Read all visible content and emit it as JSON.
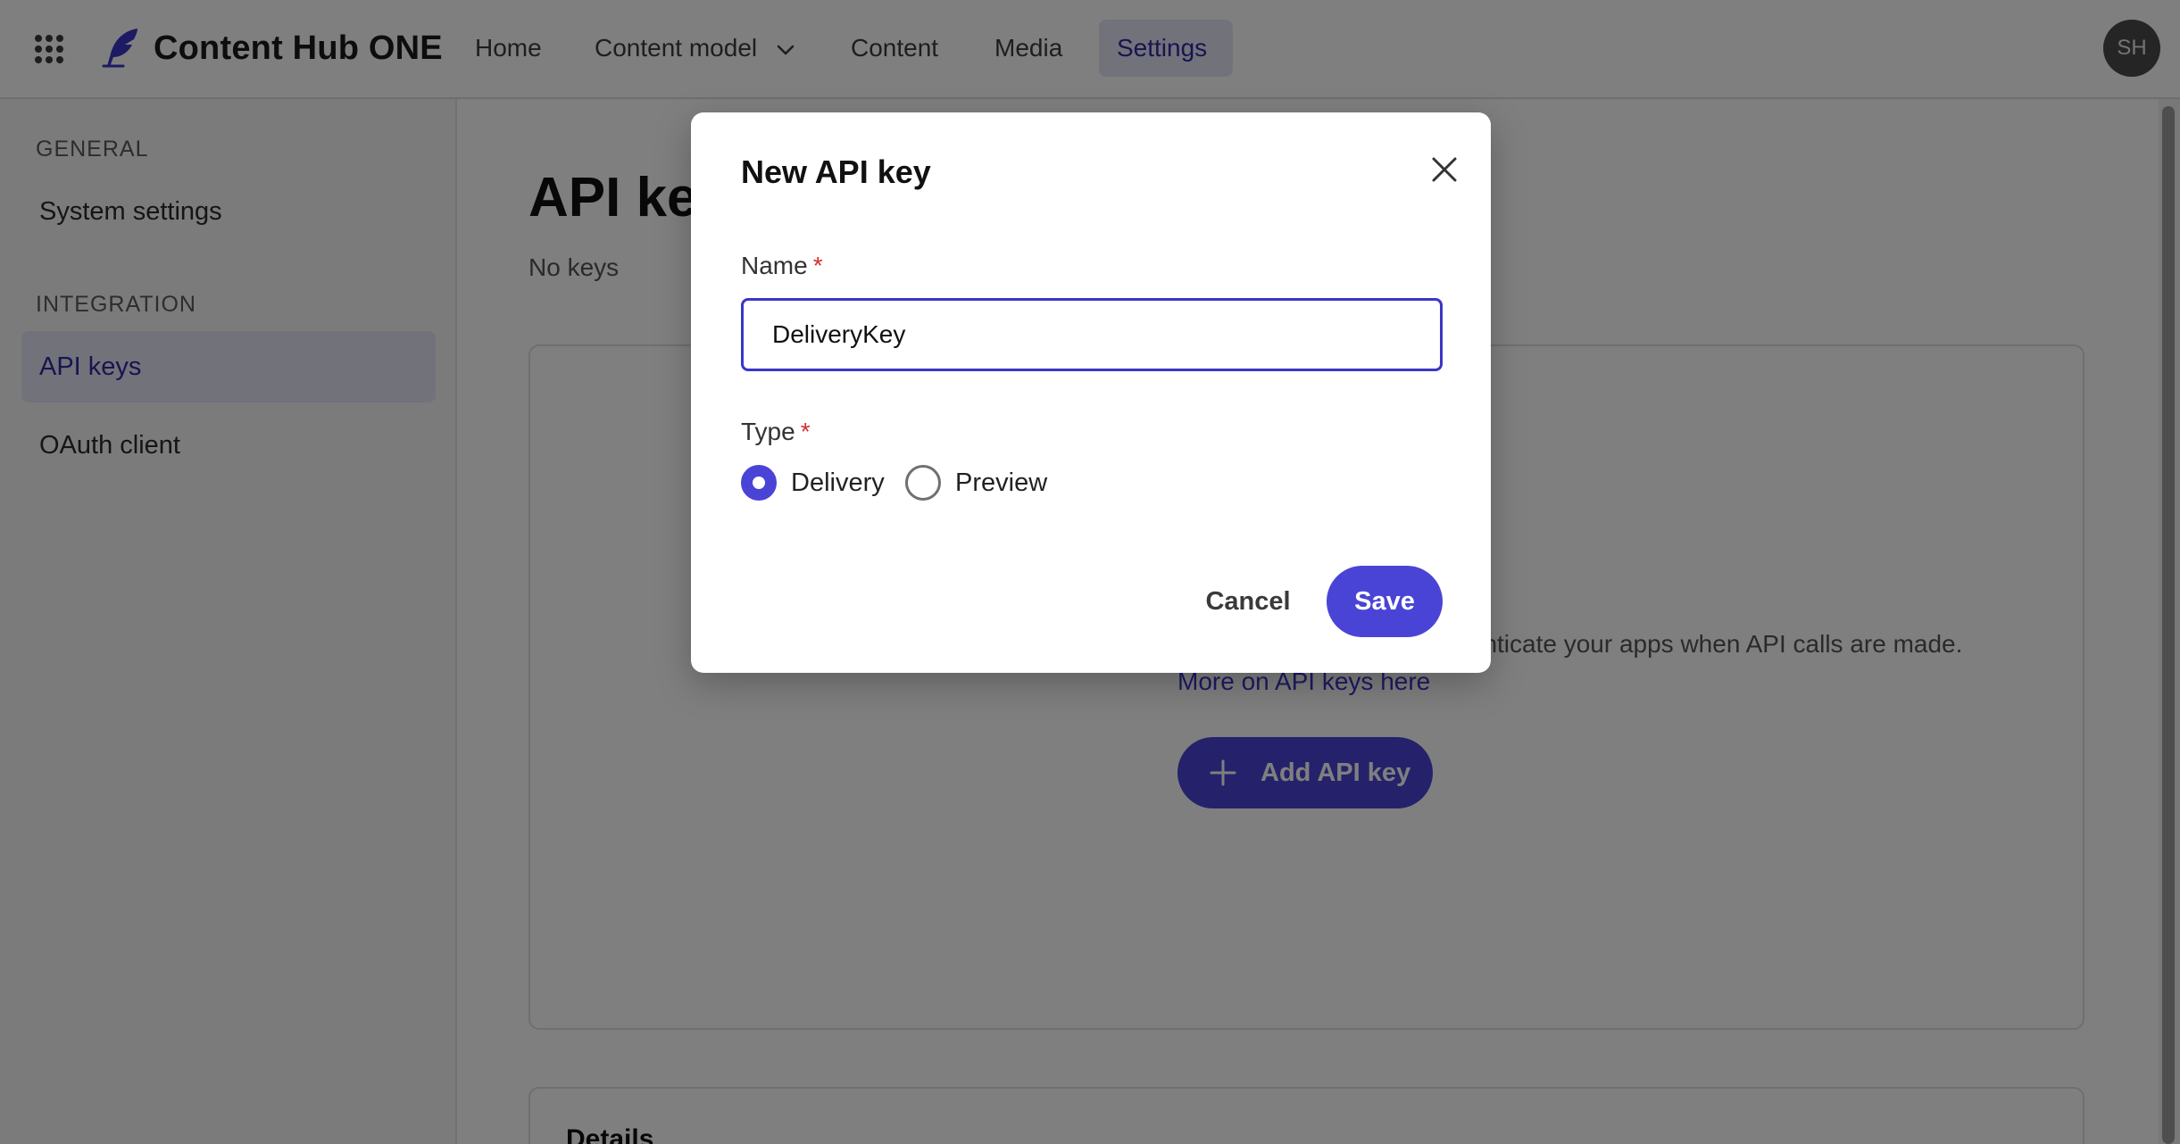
{
  "header": {
    "brand": "Content Hub ONE",
    "nav": {
      "home": "Home",
      "content_model": "Content model",
      "content": "Content",
      "media": "Media",
      "settings": "Settings"
    },
    "avatar_initials": "SH"
  },
  "sidebar": {
    "general_heading": "GENERAL",
    "system_settings": "System settings",
    "integration_heading": "INTEGRATION",
    "api_keys": "API keys",
    "oauth_client": "OAuth client"
  },
  "main": {
    "title": "API keys",
    "count_text": "No keys",
    "empty_description": "Generate API keys to authenticate your apps when API calls are made.",
    "empty_link": "More on API keys here",
    "add_button": "Add API key",
    "details_title": "Details"
  },
  "modal": {
    "title": "New API key",
    "name_label": "Name",
    "required_mark": "*",
    "name_value": "DeliveryKey",
    "type_label": "Type",
    "type_options": [
      "Delivery",
      "Preview"
    ],
    "selected_type": "Delivery",
    "cancel": "Cancel",
    "save": "Save"
  },
  "icons": {
    "apps": "apps-grid-icon",
    "logo": "quill-logo-icon",
    "chevron": "chevron-down-icon",
    "close": "close-icon",
    "plus": "plus-icon"
  },
  "colors": {
    "accent": "#4a44d6",
    "accent_text": "#3b36c7",
    "active_bg": "#e5e4f6",
    "required": "#d32f2f"
  }
}
